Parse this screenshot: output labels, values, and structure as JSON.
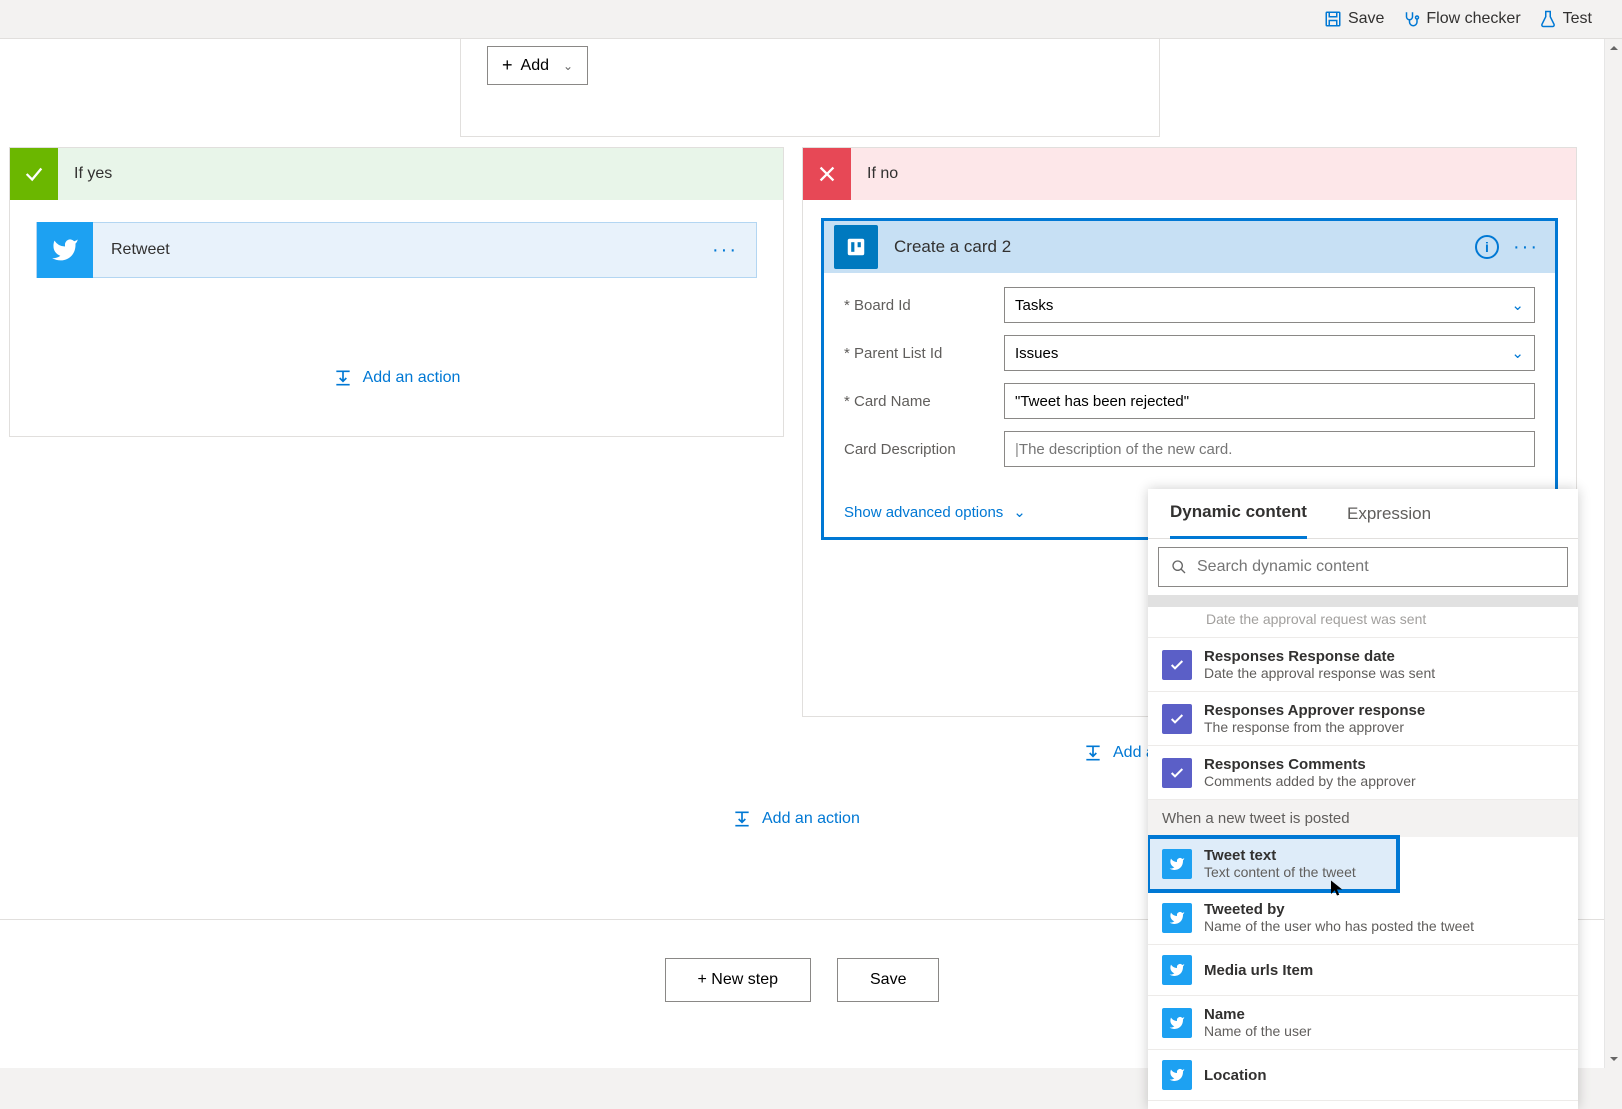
{
  "toolbar": {
    "save": "Save",
    "flowchecker": "Flow checker",
    "test": "Test"
  },
  "trigger": {
    "add": "Add"
  },
  "branches": {
    "yes": {
      "title": "If yes"
    },
    "no": {
      "title": "If no"
    }
  },
  "retweet": {
    "label": "Retweet"
  },
  "addaction": "Add an action",
  "card": {
    "title": "Create a card 2",
    "fields": {
      "boardId": {
        "label": "* Board Id",
        "value": "Tasks"
      },
      "parentListId": {
        "label": "* Parent List Id",
        "value": "Issues"
      },
      "cardName": {
        "label": "* Card Name",
        "value": "\"Tweet has been rejected\""
      },
      "cardDesc": {
        "label": "Card Description",
        "placeholder": "The description of the new card."
      }
    },
    "showadv": "Show advanced options"
  },
  "dynpop": {
    "tabs": {
      "dc": "Dynamic content",
      "ex": "Expression"
    },
    "searchPlaceholder": "Search dynamic content",
    "cutText": "Date the approval request was sent",
    "approval": [
      {
        "title": "Responses Response date",
        "desc": "Date the approval response was sent"
      },
      {
        "title": "Responses Approver response",
        "desc": "The response from the approver"
      },
      {
        "title": "Responses Comments",
        "desc": "Comments added by the approver"
      }
    ],
    "twitterSection": "When a new tweet is posted",
    "twitterItems": [
      {
        "title": "Tweet text",
        "desc": "Text content of the tweet",
        "selected": true
      },
      {
        "title": "Tweeted by",
        "desc": "Name of the user who has posted the tweet"
      },
      {
        "title": "Media urls Item",
        "desc": ""
      },
      {
        "title": "Name",
        "desc": "Name of the user"
      },
      {
        "title": "Location",
        "desc": ""
      }
    ]
  },
  "footer": {
    "newstep": "+ New step",
    "save": "Save"
  }
}
